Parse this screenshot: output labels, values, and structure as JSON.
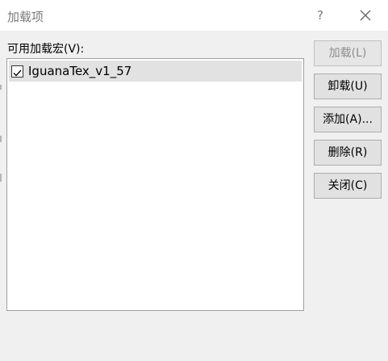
{
  "dialog": {
    "title": "加载项",
    "help_label": "?"
  },
  "addins": {
    "list_label": "可用加载宏(V):",
    "items": [
      {
        "label": "IguanaTex_v1_57",
        "checked": true,
        "selected": true
      }
    ]
  },
  "buttons": {
    "load": {
      "label": "加载(L)",
      "enabled": false
    },
    "unload": {
      "label": "卸载(U)",
      "enabled": true
    },
    "add": {
      "label": "添加(A)...",
      "enabled": true
    },
    "remove": {
      "label": "删除(R)",
      "enabled": true
    },
    "close": {
      "label": "关闭(C)",
      "enabled": true
    }
  },
  "colors": {
    "title_text": "#7a7a7a",
    "dialog_bg": "#f0f0f0",
    "selected_row": "#e2e2e2",
    "button_bg": "#e1e1e1"
  }
}
